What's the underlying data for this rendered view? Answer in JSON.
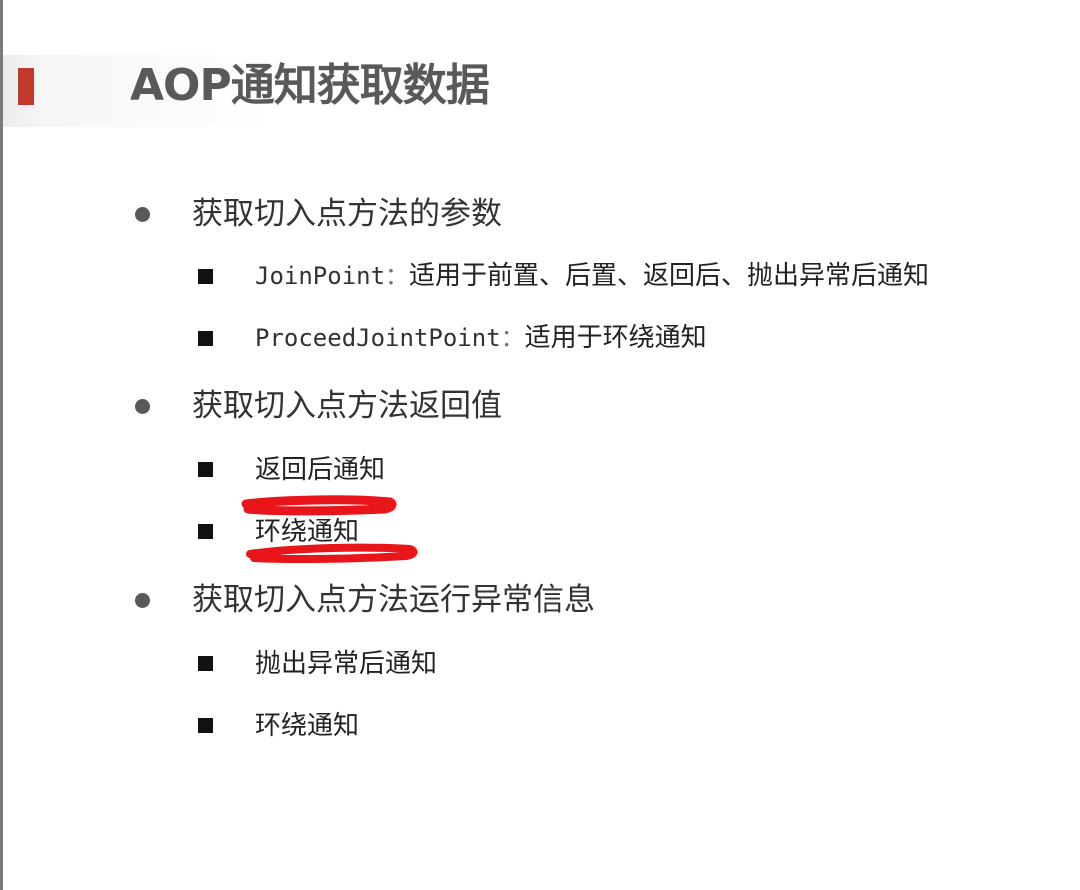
{
  "title": "AOP通知获取数据",
  "sections": [
    {
      "label": "获取切入点方法的参数",
      "items": [
        {
          "code": "JoinPoint",
          "sep": "：",
          "text": "适用于前置、后置、返回后、抛出异常后通知"
        },
        {
          "code": "ProceedJointPoint",
          "sep": "：",
          "text": "适用于环绕通知"
        }
      ]
    },
    {
      "label": "获取切入点方法返回值",
      "items": [
        {
          "text": "返回后通知"
        },
        {
          "text": "环绕通知"
        }
      ]
    },
    {
      "label": "获取切入点方法运行异常信息",
      "items": [
        {
          "text": "抛出异常后通知"
        },
        {
          "text": "环绕通知"
        }
      ]
    }
  ],
  "colors": {
    "accent": "#c0392b",
    "title": "#595959",
    "annotation": "#e8161b"
  }
}
